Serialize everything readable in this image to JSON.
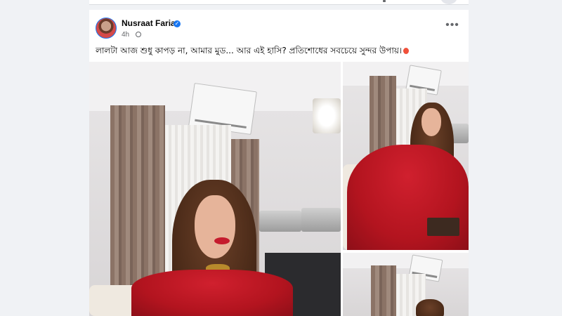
{
  "post": {
    "author": "Nusraat Faria",
    "time": "4h",
    "caption": "লালটা আজ শুধু কাপড় না, আমার মুড... আর এই হাসি? প্রতিশোধের সবচেয়ে সুন্দর উপায়।",
    "more_symbol": "•••",
    "verified_symbol": "✓"
  },
  "icons": {
    "verified": "verified-badge-icon",
    "audience": "globe-icon",
    "more": "more-options-icon",
    "emoji": "balloon-emoji-icon"
  },
  "colors": {
    "background": "#f0f2f5",
    "card": "#ffffff",
    "accent": "#1877f2",
    "text_primary": "#050505",
    "text_secondary": "#65676b",
    "dress_red": "#b3141f"
  },
  "photos": [
    {
      "name": "photo-main"
    },
    {
      "name": "photo-top-right"
    },
    {
      "name": "photo-bottom-right"
    }
  ]
}
